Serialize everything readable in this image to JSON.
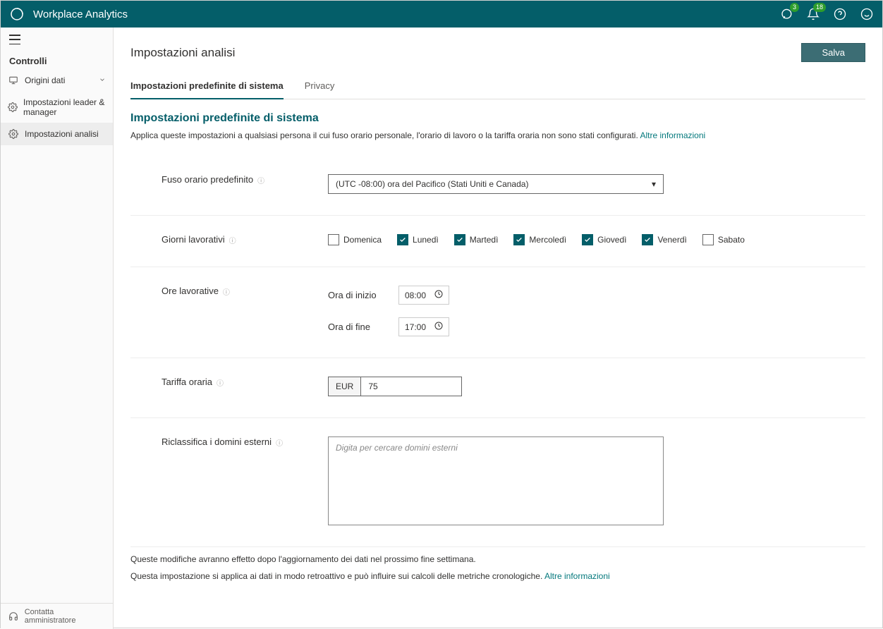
{
  "header": {
    "title": "Workplace Analytics",
    "feedback_badge": "3",
    "notifications_badge": "18"
  },
  "sidebar": {
    "section": "Controlli",
    "items": [
      {
        "label": "Origini dati",
        "expandable": true
      },
      {
        "label": "Impostazioni leader & manager"
      },
      {
        "label": "Impostazioni analisi",
        "active": true
      }
    ],
    "footer": "Contatta amministratore"
  },
  "page": {
    "title": "Impostazioni analisi",
    "save_button": "Salva"
  },
  "tabs": [
    {
      "label": "Impostazioni predefinite di sistema",
      "active": true
    },
    {
      "label": "Privacy"
    }
  ],
  "section": {
    "title": "Impostazioni predefinite di sistema",
    "desc": "Applica queste impostazioni a qualsiasi persona il cui fuso orario personale, l'orario di lavoro o la tariffa oraria non sono stati configurati.",
    "more_link": "Altre informazioni"
  },
  "fields": {
    "timezone": {
      "label": "Fuso orario predefinito",
      "value": "(UTC -08:00) ora del Pacifico (Stati Uniti e Canada)"
    },
    "workdays": {
      "label": "Giorni lavorativi",
      "days": [
        {
          "label": "Domenica",
          "checked": false
        },
        {
          "label": "Lunedì",
          "checked": true
        },
        {
          "label": "Martedì",
          "checked": true
        },
        {
          "label": "Mercoledì",
          "checked": true
        },
        {
          "label": "Giovedì",
          "checked": true
        },
        {
          "label": "Venerdì",
          "checked": true
        },
        {
          "label": "Sabato",
          "checked": false
        }
      ]
    },
    "workhours": {
      "label": "Ore lavorative",
      "start_label": "Ora di inizio",
      "start_value": "08:00",
      "end_label": "Ora di fine",
      "end_value": "17:00"
    },
    "hourly_rate": {
      "label": "Tariffa oraria",
      "currency": "EUR",
      "value": "75"
    },
    "reclassify": {
      "label": "Riclassifica i domini esterni",
      "placeholder": "Digita per cercare domini esterni"
    }
  },
  "notes": {
    "line1": "Queste modifiche avranno effetto dopo l'aggiornamento dei dati nel prossimo fine settimana.",
    "line2": "Questa impostazione si applica ai dati in modo retroattivo e può influire sui calcoli delle metriche cronologiche.",
    "line2_link": "Altre informazioni"
  }
}
